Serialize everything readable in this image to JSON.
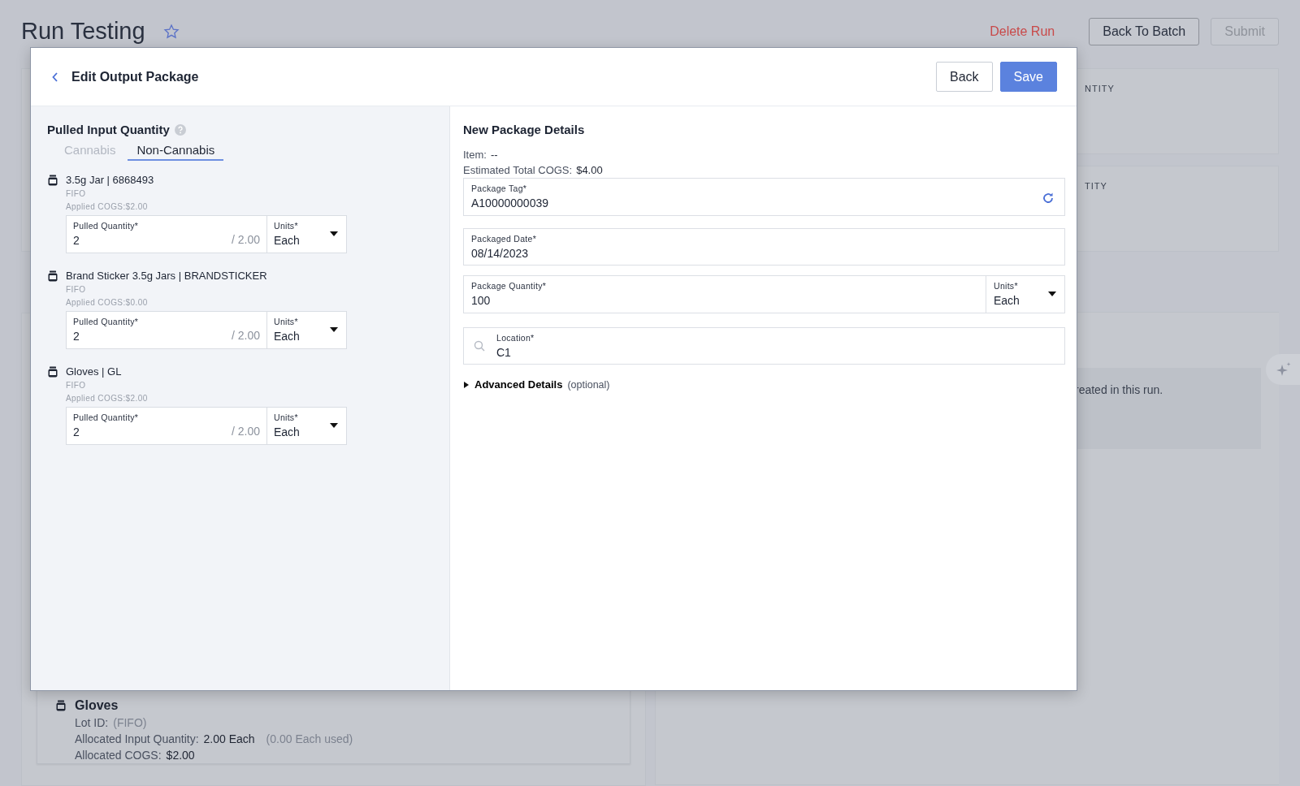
{
  "page": {
    "title": "Run Testing",
    "starred": false,
    "actions": [
      {
        "label": "Delete Run",
        "kind": "danger",
        "disabled": false
      },
      {
        "label": "Back To Batch",
        "kind": "outline",
        "disabled": false
      },
      {
        "label": "Submit",
        "kind": "outline",
        "disabled": true
      }
    ],
    "side_cards": [
      "NTITY",
      "TITY"
    ],
    "notice": "reated in this run.",
    "input_card": {
      "name": "Gloves",
      "lot_label": "Lot ID:",
      "lot_value": "(FIFO)",
      "alloc_label": "Allocated Input Quantity:",
      "alloc_value": "2.00 Each",
      "alloc_used": "(0.00 Each used)",
      "cogs_label": "Allocated COGS:",
      "cogs_value": "$2.00"
    }
  },
  "modal": {
    "title": "Edit Output Package",
    "buttons": [
      {
        "label": "Back",
        "kind": "secondary"
      },
      {
        "label": "Save",
        "kind": "primary"
      }
    ],
    "left": {
      "heading": "Pulled Input Quantity",
      "tabs": [
        {
          "label": "Cannabis",
          "selected": false
        },
        {
          "label": "Non-Cannabis",
          "selected": true
        }
      ],
      "inputs": [
        {
          "name": "3.5g Jar | 6868493",
          "method": "FIFO",
          "cogs": "Applied COGS:$2.00",
          "quantity_label": "Pulled Quantity*",
          "quantity": "2",
          "max": "/ 2.00",
          "units_label": "Units*",
          "units": "Each"
        },
        {
          "name": "Brand Sticker 3.5g Jars | BRANDSTICKER",
          "method": "FIFO",
          "cogs": "Applied COGS:$0.00",
          "quantity_label": "Pulled Quantity*",
          "quantity": "2",
          "max": "/ 2.00",
          "units_label": "Units*",
          "units": "Each"
        },
        {
          "name": "Gloves | GL",
          "method": "FIFO",
          "cogs": "Applied COGS:$2.00",
          "quantity_label": "Pulled Quantity*",
          "quantity": "2",
          "max": "/ 2.00",
          "units_label": "Units*",
          "units": "Each"
        }
      ]
    },
    "right": {
      "heading": "New Package Details",
      "item_label": "Item:",
      "item_value": "--",
      "cogs_label": "Estimated Total COGS:",
      "cogs_value": "$4.00",
      "fields": [
        {
          "kind": "tag",
          "label": "Package Tag*",
          "value": "A10000000039"
        },
        {
          "kind": "text",
          "label": "Packaged Date*",
          "value": "08/14/2023"
        },
        {
          "kind": "quantity",
          "label": "Package Quantity*",
          "value": "100",
          "units_label": "Units*",
          "units": "Each"
        },
        {
          "kind": "search",
          "label": "Location*",
          "value": "C1"
        }
      ],
      "advanced": {
        "label": "Advanced Details",
        "note": "(optional)",
        "expanded": false
      }
    }
  }
}
